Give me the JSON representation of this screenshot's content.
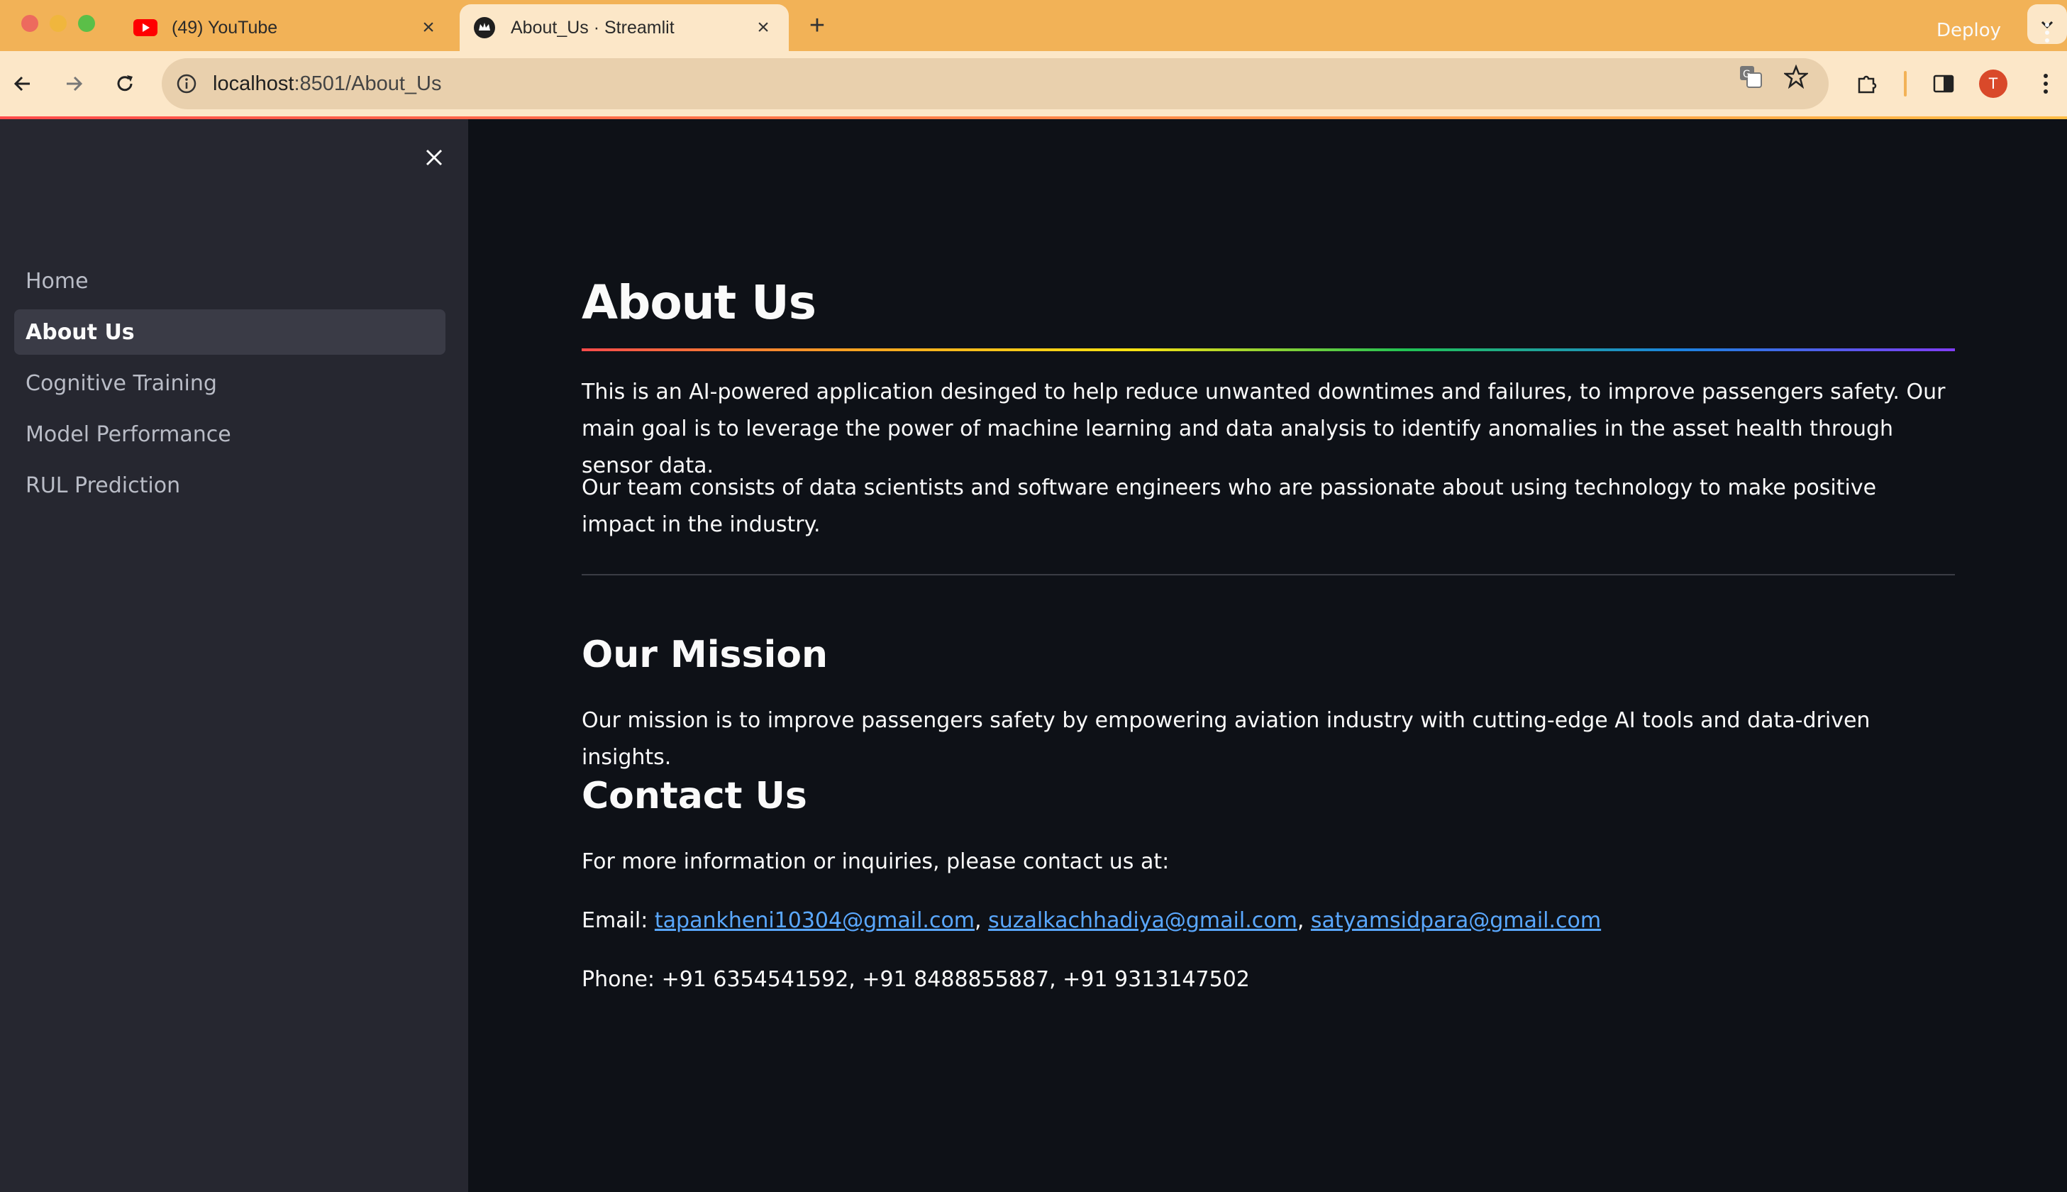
{
  "browser": {
    "tabs": [
      {
        "title": "(49) YouTube",
        "favicon": "youtube-icon",
        "active": false
      },
      {
        "title": "About_Us · Streamlit",
        "favicon": "streamlit-icon",
        "active": true
      }
    ],
    "url_host": "localhost",
    "url_path": ":8501/About_Us",
    "profile_initial": "T",
    "colors": {
      "tabbar": "#f2b257",
      "toolbar": "#fce7c8",
      "omnibox": "#e9d0ad"
    }
  },
  "sidebar": {
    "items": [
      {
        "label": "Home",
        "active": false
      },
      {
        "label": "About Us",
        "active": true
      },
      {
        "label": "Cognitive Training",
        "active": false
      },
      {
        "label": "Model Performance",
        "active": false
      },
      {
        "label": "RUL Prediction",
        "active": false
      }
    ]
  },
  "header": {
    "deploy_label": "Deploy"
  },
  "page": {
    "title": "About Us",
    "intro": "This is an AI-powered application desinged to help reduce unwanted downtimes and failures, to improve passengers safety. Our main goal is to leverage the power of machine learning and data analysis to identify anomalies in the asset health through sensor data.",
    "team": "Our team consists of data scientists and software engineers who are passionate about using technology to make positive impact in the industry.",
    "mission_heading": "Our Mission",
    "mission_text": "Our mission is to improve passengers safety by empowering aviation industry with cutting-edge AI tools and data-driven insights.",
    "contact_heading": "Contact Us",
    "contact_intro": "For more information or inquiries, please contact us at:",
    "email_label": "Email:",
    "emails": [
      "tapankheni10304@gmail.com",
      "suzalkachhadiya@gmail.com",
      "satyamsidpara@gmail.com"
    ],
    "phone": "Phone: +91 6354541592, +91 8488855887, +91 9313147502"
  },
  "theme": {
    "bg": "#0e1117",
    "sidebar_bg": "#262730",
    "link": "#5aa8ff"
  }
}
